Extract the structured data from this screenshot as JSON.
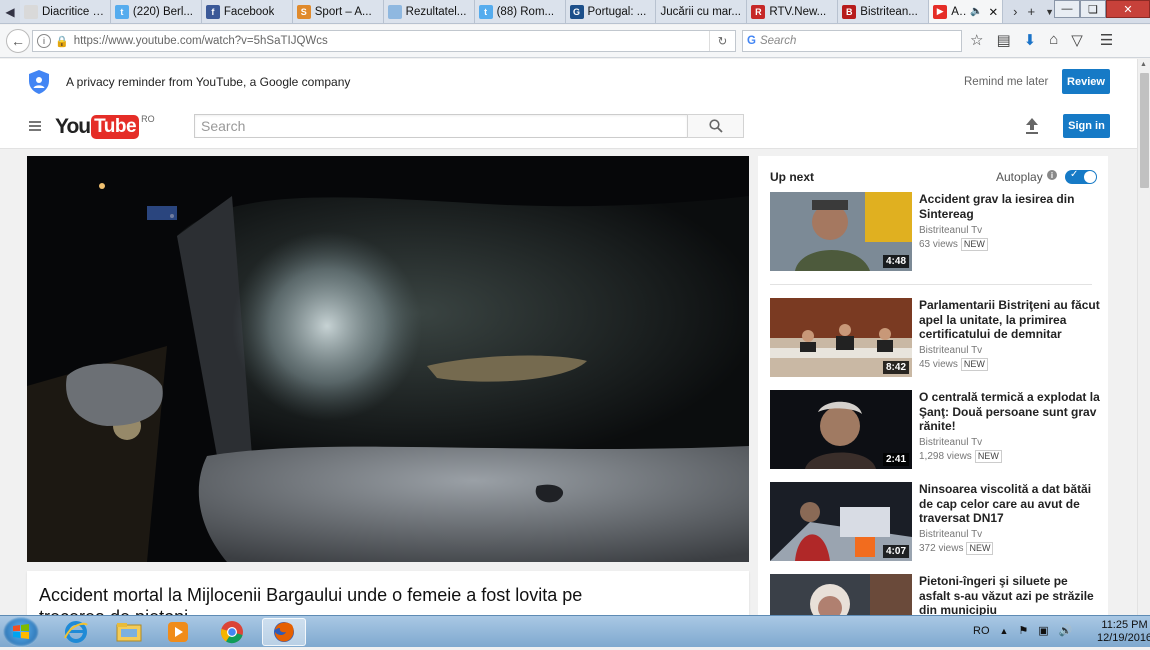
{
  "browser": {
    "tabs": [
      {
        "label": "Diacritice (ăâî...",
        "icon": "page-icon"
      },
      {
        "label": "(220) Berl...",
        "icon": "twitter-icon"
      },
      {
        "label": "Facebook",
        "icon": "facebook-icon"
      },
      {
        "label": "Sport – A...",
        "icon": "sport-icon"
      },
      {
        "label": "Rezultatel...",
        "icon": "page-icon"
      },
      {
        "label": "(88) Rom...",
        "icon": "twitter-icon"
      },
      {
        "label": "Portugal: ...",
        "icon": "page-icon"
      },
      {
        "label": "Jucării cu mar...",
        "icon": "none"
      },
      {
        "label": "RTV.New...",
        "icon": "rtv-icon"
      },
      {
        "label": "Bistritean...",
        "icon": "b-icon"
      },
      {
        "label": "A...",
        "icon": "youtube-icon"
      }
    ],
    "url": "https://www.youtube.com/watch?v=5hSaTIJQWcs",
    "search_placeholder": "Search"
  },
  "privacy": {
    "text": "A privacy reminder from YouTube, a Google company",
    "remind_label": "Remind me later",
    "review_label": "Review"
  },
  "header": {
    "logo_you": "You",
    "logo_tube": "Tube",
    "country": "RO",
    "search_placeholder": "Search",
    "signin_label": "Sign in"
  },
  "video": {
    "title": "Accident mortal la Mijlocenii Bargaului unde o femeie a fost lovita pe trecerea de pietoni"
  },
  "sidebar": {
    "upnext_label": "Up next",
    "autoplay_label": "Autoplay",
    "items": [
      {
        "title": "Accident grav la iesirea din Sintereag",
        "channel": "Bistriteanul Tv",
        "views": "63 views",
        "badge": "NEW",
        "duration": "4:48"
      },
      {
        "title": "Parlamentarii Bistriţeni au făcut apel la unitate, la primirea certificatului de demnitar",
        "channel": "Bistriteanul Tv",
        "views": "45 views",
        "badge": "NEW",
        "duration": "8:42"
      },
      {
        "title": "O centrală termică a explodat la Şanţ: Două persoane sunt grav rănite!",
        "channel": "Bistriteanul Tv",
        "views": "1,298 views",
        "badge": "NEW",
        "duration": "2:41"
      },
      {
        "title": "Ninsoarea viscolită a dat bătăi de cap celor care au avut de traversat DN17",
        "channel": "Bistriteanul Tv",
        "views": "372 views",
        "badge": "NEW",
        "duration": "4:07"
      },
      {
        "title": "Pietoni-îngeri şi siluete pe asfalt s-au văzut azi pe străzile din municipiu",
        "channel": "",
        "views": "",
        "badge": "",
        "duration": ""
      }
    ]
  },
  "taskbar": {
    "lang": "RO",
    "time": "11:25 PM",
    "date": "12/19/2016"
  },
  "colors": {
    "accent": "#167ac6",
    "youtube_red": "#e52d27"
  }
}
